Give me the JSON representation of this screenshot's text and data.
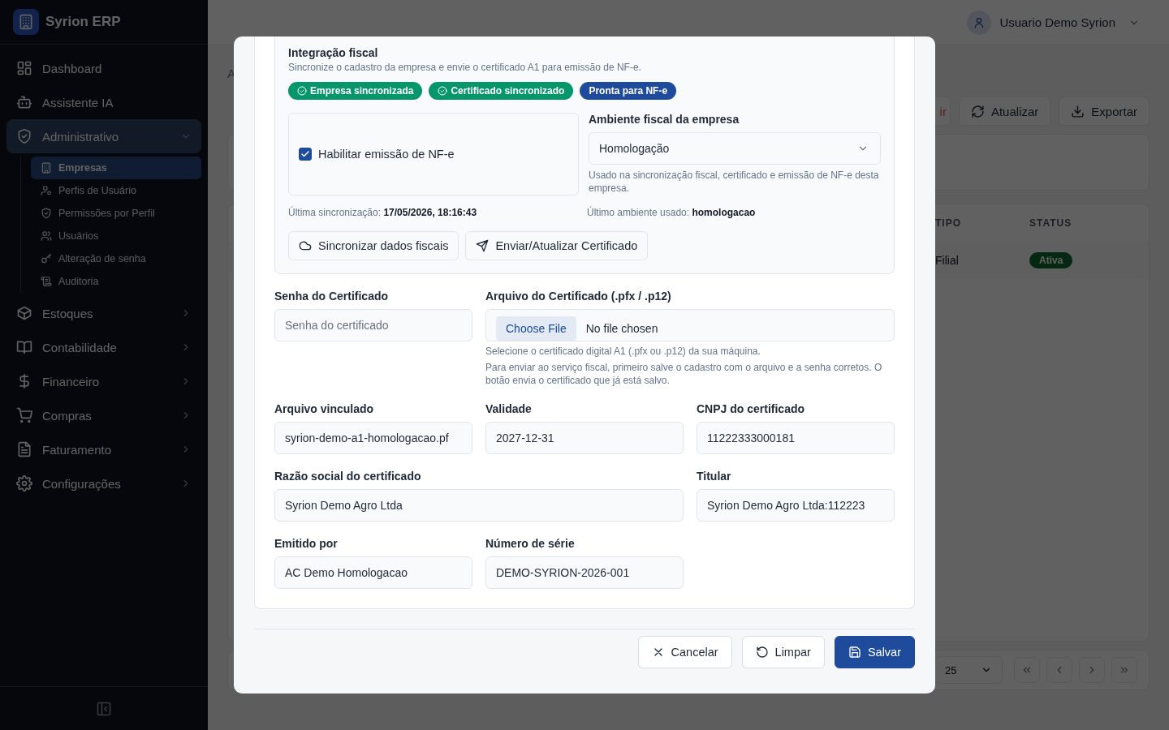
{
  "sidebar": {
    "brand": "Syrion ERP",
    "items": [
      {
        "label": "Dashboard",
        "kind": "link",
        "selected": false
      },
      {
        "label": "Assistente IA",
        "kind": "link",
        "selected": false
      },
      {
        "label": "Administrativo",
        "kind": "group",
        "selected": true,
        "expanded": true,
        "children": [
          {
            "label": "Empresas",
            "selected": true
          },
          {
            "label": "Perfis de Usuário",
            "selected": false
          },
          {
            "label": "Permissões por Perfil",
            "selected": false
          },
          {
            "label": "Usuários",
            "selected": false
          },
          {
            "label": "Alteração de senha",
            "selected": false
          },
          {
            "label": "Auditoria",
            "selected": false
          }
        ]
      },
      {
        "label": "Estoques",
        "kind": "group",
        "selected": false,
        "expanded": false
      },
      {
        "label": "Contabilidade",
        "kind": "group",
        "selected": false,
        "expanded": false
      },
      {
        "label": "Financeiro",
        "kind": "group",
        "selected": false,
        "expanded": false
      },
      {
        "label": "Compras",
        "kind": "group",
        "selected": false,
        "expanded": false
      },
      {
        "label": "Faturamento",
        "kind": "group",
        "selected": false,
        "expanded": false
      },
      {
        "label": "Configurações",
        "kind": "group",
        "selected": false,
        "expanded": false
      }
    ]
  },
  "header": {
    "user": "Usuario Demo Syrion"
  },
  "page": {
    "breadcrumb": "A",
    "toolbar": [
      {
        "label": "ir",
        "kind": "danger"
      },
      {
        "label": "Atualizar",
        "kind": "refresh"
      },
      {
        "label": "Exportar",
        "kind": "export"
      }
    ],
    "table": {
      "columns": [
        "TIPO",
        "STATUS"
      ],
      "rows": [
        {
          "tipo": "Filial",
          "status": "Ativa"
        }
      ]
    },
    "page_size": "25"
  },
  "modal": {
    "fiscal": {
      "title": "Integração fiscal",
      "subtitle": "Sincronize o cadastro da empresa e envie o certificado A1 para emissão de NF-e.",
      "badges": [
        {
          "label": "Empresa sincronizada",
          "kind": "done",
          "color": "#059669"
        },
        {
          "label": "Certificado sincronizado",
          "kind": "done",
          "color": "#059669"
        },
        {
          "label": "Pronta para NF-e",
          "kind": "ready",
          "color": "#1e4b9c"
        }
      ],
      "enable": {
        "label": "Habilitar emissão de NF-e",
        "checked": true
      },
      "environment": {
        "label": "Ambiente fiscal da empresa",
        "value": "Homologação",
        "help": "Usado na sincronização fiscal, certificado e emissão de NF-e desta empresa."
      },
      "last_sync": "Última sincronização: **17/05/2026, 18:16:43**",
      "last_env": "Último ambiente usado: **homologacao**",
      "actions": [
        {
          "label": "Sincronizar dados fiscais",
          "kind": "sync"
        },
        {
          "label": "Enviar/Atualizar Certificado",
          "kind": "send"
        }
      ]
    },
    "fields": [
      {
        "label": "Senha do Certificado",
        "kind": "input",
        "placeholder": "Senha do certificado"
      },
      {
        "label": "Arquivo do Certificado (.pfx / .p12)",
        "kind": "file",
        "button": "Choose File",
        "value": "No file chosen",
        "hints": [
          "Selecione o certificado digital A1 (.pfx ou .p12) da sua máquina.",
          "Para enviar ao serviço fiscal, primeiro salve o cadastro com o arquivo e a senha corretos. O botão envia o certificado que já está salvo."
        ]
      },
      {
        "label": "Arquivo vinculado",
        "kind": "input",
        "value": "syrion-demo-a1-homologacao.pf"
      },
      {
        "label": "Validade",
        "kind": "input",
        "value": "2027-12-31"
      },
      {
        "label": "CNPJ do certificado",
        "kind": "input",
        "value": "11222333000181"
      },
      {
        "label": "Razão social do certificado",
        "kind": "input",
        "value": "Syrion Demo Agro Ltda"
      },
      {
        "label": "Titular",
        "kind": "input",
        "value": "Syrion Demo Agro Ltda:112223"
      },
      {
        "label": "Emitido por",
        "kind": "input",
        "value": "AC Demo Homologacao"
      },
      {
        "label": "Número de série",
        "kind": "input",
        "value": "DEMO-SYRION-2026-001"
      }
    ],
    "buttons": [
      {
        "label": "Cancelar",
        "kind": "cancel"
      },
      {
        "label": "Limpar",
        "kind": "reset"
      },
      {
        "label": "Salvar",
        "kind": "save"
      }
    ]
  }
}
